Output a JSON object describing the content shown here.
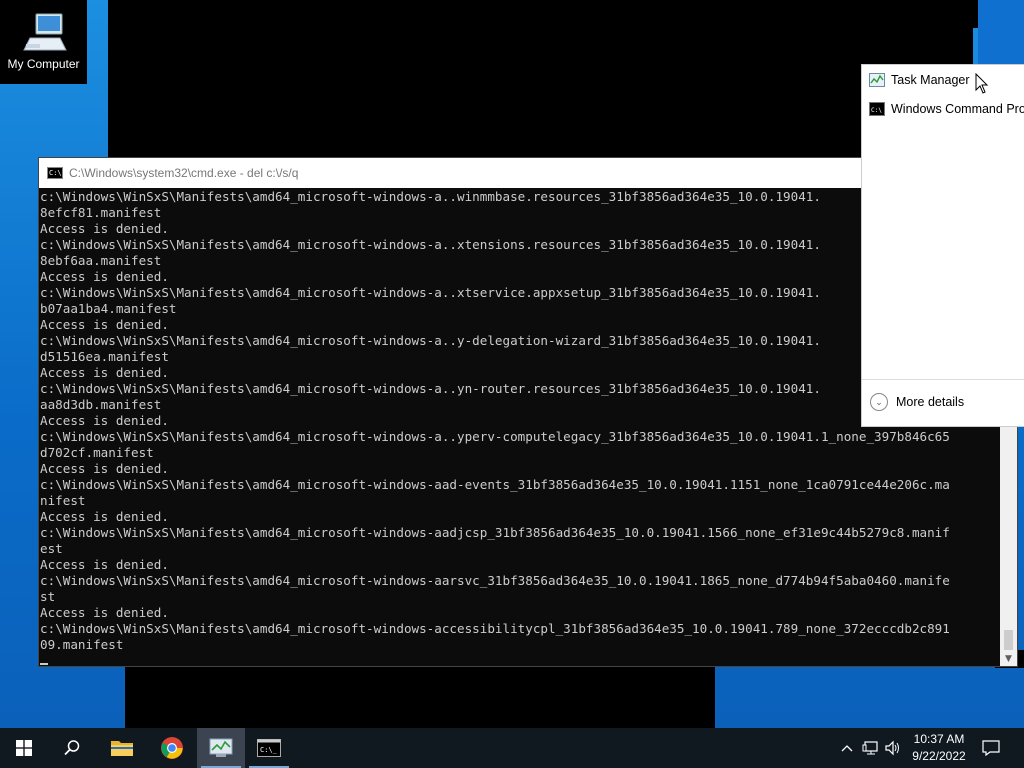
{
  "desktop": {
    "icons": [
      {
        "label": "My Computer",
        "icon": "computer-icon"
      }
    ]
  },
  "cmd": {
    "title": "C:\\Windows\\system32\\cmd.exe - del  c:\\/s/q",
    "lines": [
      "c:\\Windows\\WinSxS\\Manifests\\amd64_microsoft-windows-a..winmmbase.resources_31bf3856ad364e35_10.0.19041.",
      "8efcf81.manifest",
      "Access is denied.",
      "c:\\Windows\\WinSxS\\Manifests\\amd64_microsoft-windows-a..xtensions.resources_31bf3856ad364e35_10.0.19041.",
      "8ebf6aa.manifest",
      "Access is denied.",
      "c:\\Windows\\WinSxS\\Manifests\\amd64_microsoft-windows-a..xtservice.appxsetup_31bf3856ad364e35_10.0.19041.",
      "b07aa1ba4.manifest",
      "Access is denied.",
      "c:\\Windows\\WinSxS\\Manifests\\amd64_microsoft-windows-a..y-delegation-wizard_31bf3856ad364e35_10.0.19041.",
      "d51516ea.manifest",
      "Access is denied.",
      "c:\\Windows\\WinSxS\\Manifests\\amd64_microsoft-windows-a..yn-router.resources_31bf3856ad364e35_10.0.19041.",
      "aa8d3db.manifest",
      "Access is denied.",
      "c:\\Windows\\WinSxS\\Manifests\\amd64_microsoft-windows-a..yperv-computelegacy_31bf3856ad364e35_10.0.19041.1_none_397b846c65",
      "d702cf.manifest",
      "Access is denied.",
      "c:\\Windows\\WinSxS\\Manifests\\amd64_microsoft-windows-aad-events_31bf3856ad364e35_10.0.19041.1151_none_1ca0791ce44e206c.ma",
      "nifest",
      "Access is denied.",
      "c:\\Windows\\WinSxS\\Manifests\\amd64_microsoft-windows-aadjcsp_31bf3856ad364e35_10.0.19041.1566_none_ef31e9c44b5279c8.manif",
      "est",
      "Access is denied.",
      "c:\\Windows\\WinSxS\\Manifests\\amd64_microsoft-windows-aarsvc_31bf3856ad364e35_10.0.19041.1865_none_d774b94f5aba0460.manife",
      "st",
      "Access is denied.",
      "c:\\Windows\\WinSxS\\Manifests\\amd64_microsoft-windows-accessibilitycpl_31bf3856ad364e35_10.0.19041.789_none_372ecccdb2c891",
      "09.manifest"
    ]
  },
  "jump_list": {
    "items": [
      {
        "label": "Task Manager",
        "icon": "task-manager-icon"
      },
      {
        "label": "Windows Command Processor",
        "icon": "cmd-icon"
      }
    ],
    "more_details": "More details"
  },
  "taskbar": {
    "buttons": [
      {
        "name": "start",
        "icon": "windows-logo-icon"
      },
      {
        "name": "search",
        "icon": "search-icon"
      },
      {
        "name": "file-explorer",
        "icon": "folder-icon"
      },
      {
        "name": "chrome",
        "icon": "chrome-icon"
      },
      {
        "name": "task-manager",
        "icon": "task-manager-icon",
        "active": true
      },
      {
        "name": "cmd",
        "icon": "cmd-icon",
        "running": true
      }
    ],
    "time": "10:37 AM",
    "date": "9/22/2022"
  },
  "colors": {
    "desktop": "#0a6cc8",
    "taskbar": "#101820",
    "console_bg": "#0c0c0c",
    "console_fg": "#cccccc"
  }
}
